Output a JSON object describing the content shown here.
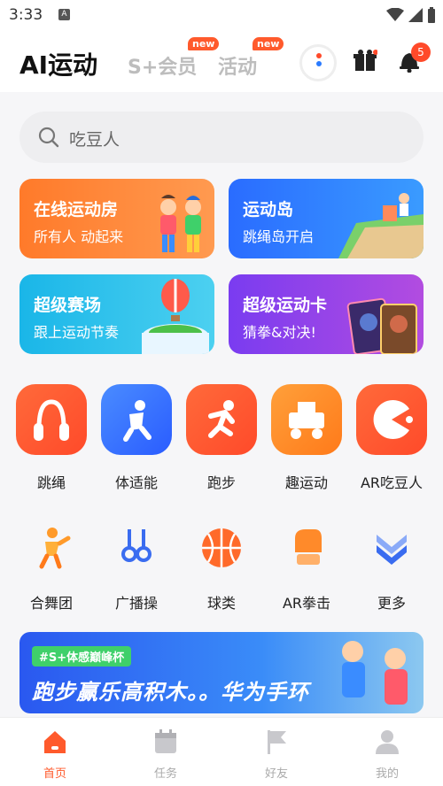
{
  "status_bar": {
    "time": "3:33"
  },
  "header": {
    "tabs": [
      {
        "label": "AI运动"
      },
      {
        "label": "S+会员",
        "badge": "new"
      },
      {
        "label": "活动",
        "badge": "new"
      }
    ],
    "notification_count": "5"
  },
  "search": {
    "placeholder": "吃豆人"
  },
  "cards": [
    {
      "title": "在线运动房",
      "subtitle": "所有人 动起来"
    },
    {
      "title": "运动岛",
      "subtitle": "跳绳岛开启"
    },
    {
      "title": "超级赛场",
      "subtitle": "跟上运动节奏"
    },
    {
      "title": "超级运动卡",
      "subtitle": "猜拳&对决!"
    }
  ],
  "grid_row1": [
    {
      "label": "跳绳",
      "icon": "jump-rope-icon"
    },
    {
      "label": "体适能",
      "icon": "fitness-icon"
    },
    {
      "label": "跑步",
      "icon": "running-icon"
    },
    {
      "label": "趣运动",
      "icon": "fun-sports-icon"
    },
    {
      "label": "AR吃豆人",
      "icon": "pacman-icon"
    }
  ],
  "grid_row2": [
    {
      "label": "合舞团",
      "icon": "dance-icon"
    },
    {
      "label": "广播操",
      "icon": "gymnastics-icon"
    },
    {
      "label": "球类",
      "icon": "basketball-icon"
    },
    {
      "label": "AR拳击",
      "icon": "boxing-glove-icon"
    },
    {
      "label": "更多",
      "icon": "more-chevron-icon"
    }
  ],
  "banner": {
    "tag": "#S+体感巅峰杯",
    "title": "跑步赢乐高积木。。华为手环"
  },
  "tabbar": [
    {
      "label": "首页",
      "active": true
    },
    {
      "label": "任务"
    },
    {
      "label": "好友"
    },
    {
      "label": "我的"
    }
  ],
  "colors": {
    "accent": "#ff5a2c",
    "blue": "#2a6cff"
  }
}
